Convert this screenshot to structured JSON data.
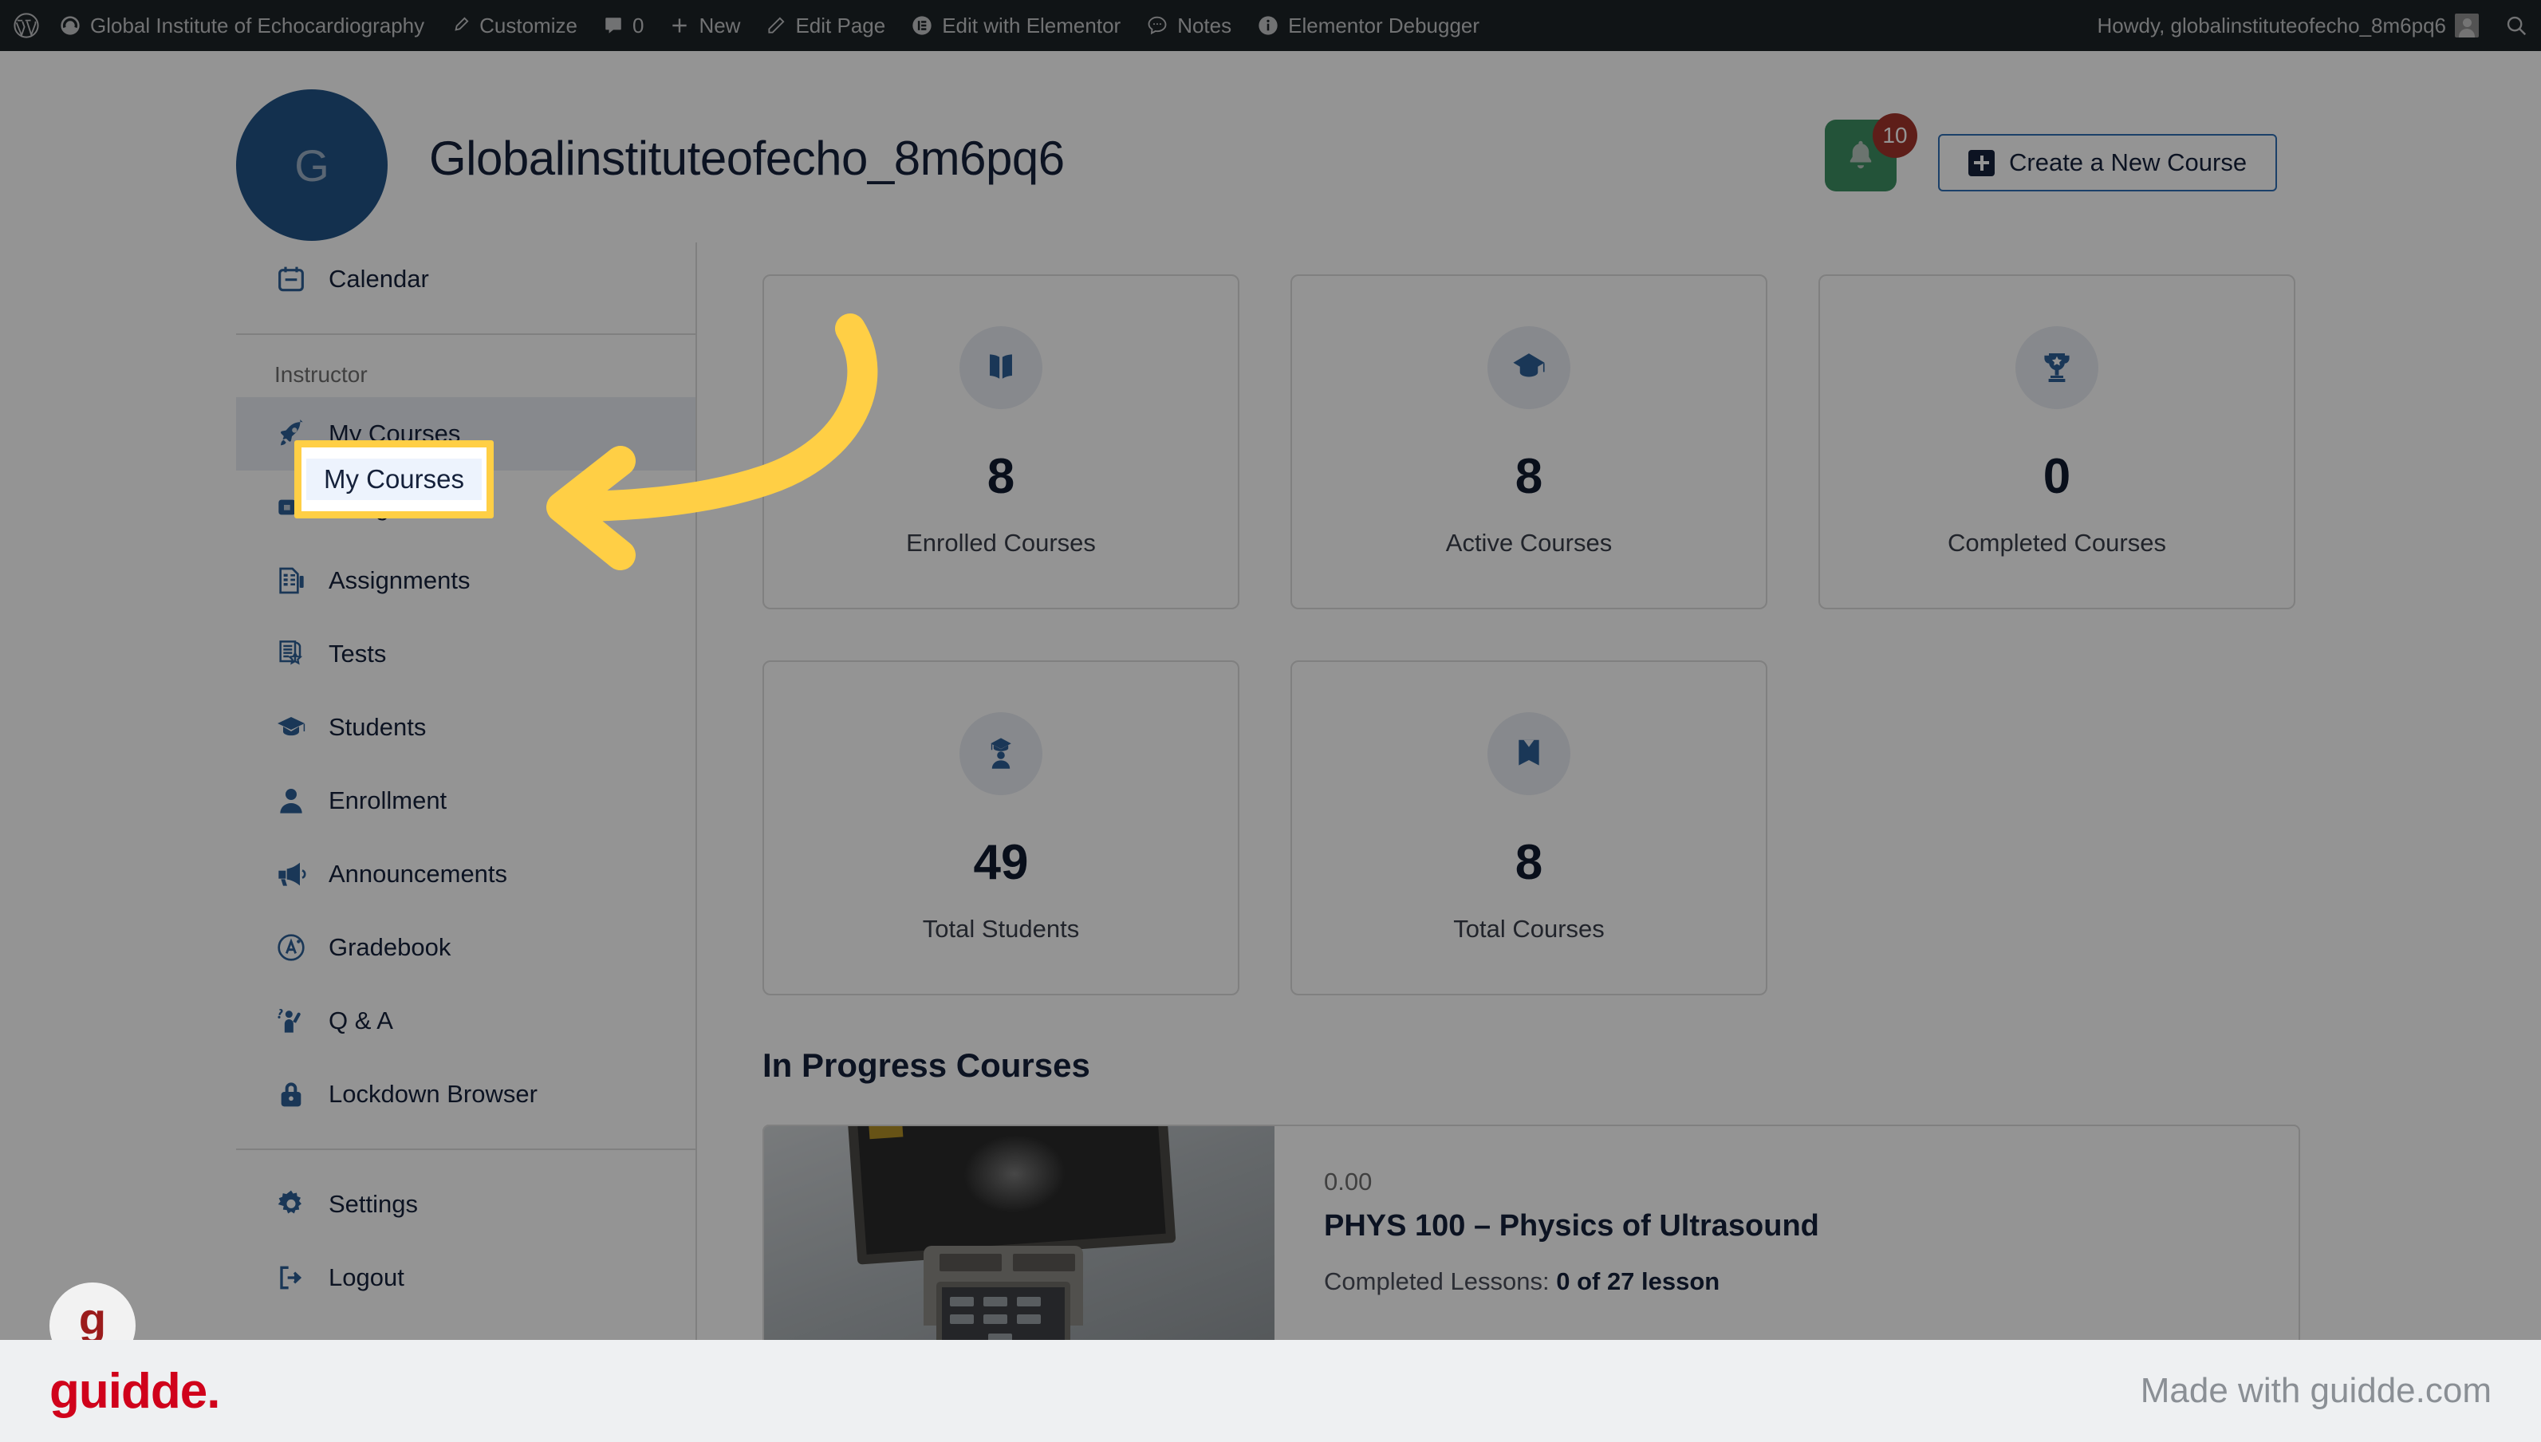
{
  "admin_bar": {
    "site_name": "Global Institute of Echocardiography",
    "items": [
      {
        "label": "Customize",
        "icon": "paintbrush-icon"
      },
      {
        "label": "0",
        "icon": "comment-icon"
      },
      {
        "label": "New",
        "icon": "plus-icon"
      },
      {
        "label": "Edit Page",
        "icon": "pencil-icon"
      },
      {
        "label": "Edit with Elementor",
        "icon": "elementor-icon"
      },
      {
        "label": "Notes",
        "icon": "notes-icon"
      },
      {
        "label": "Elementor Debugger",
        "icon": "info-icon"
      }
    ],
    "howdy": "Howdy, globalinstituteofecho_8m6pq6",
    "search_icon": "search-icon",
    "wp_logo": "wordpress-logo-icon"
  },
  "header": {
    "avatar_initial": "G",
    "title": "Globalinstituteofecho_8m6pq6",
    "notification_count": "10",
    "bell_icon": "bell-icon",
    "create_course_label": "Create a New Course"
  },
  "sidebar": {
    "top_items": [
      {
        "label": "Calendar",
        "icon": "calendar-icon"
      }
    ],
    "group_label": "Instructor",
    "instructor_items": [
      {
        "label": "My Courses",
        "icon": "rocket-icon",
        "active": true
      },
      {
        "label": "Google Meet",
        "icon": "video-camera-icon",
        "active": false
      },
      {
        "label": "Assignments",
        "icon": "assignment-doc-icon",
        "active": false
      },
      {
        "label": "Tests",
        "icon": "test-paper-icon",
        "active": false
      },
      {
        "label": "Students",
        "icon": "graduation-cap-icon",
        "active": false
      },
      {
        "label": "Enrollment",
        "icon": "person-icon",
        "active": false
      },
      {
        "label": "Announcements",
        "icon": "megaphone-icon",
        "active": false
      },
      {
        "label": "Gradebook",
        "icon": "grade-a-icon",
        "active": false
      },
      {
        "label": "Q & A",
        "icon": "raised-hand-question-icon",
        "active": false
      }
    ],
    "lockdown": {
      "label": "Lockdown Browser",
      "icon": "lock-icon"
    },
    "bottom_items": [
      {
        "label": "Settings",
        "icon": "gear-icon"
      },
      {
        "label": "Logout",
        "icon": "logout-icon"
      }
    ]
  },
  "stats": {
    "row1": [
      {
        "value": "8",
        "label": "Enrolled Courses",
        "icon": "open-book-icon"
      },
      {
        "value": "8",
        "label": "Active Courses",
        "icon": "graduation-cap-icon"
      },
      {
        "value": "0",
        "label": "Completed Courses",
        "icon": "trophy-icon"
      }
    ],
    "row2": [
      {
        "value": "49",
        "label": "Total Students",
        "icon": "student-icon"
      },
      {
        "value": "8",
        "label": "Total Courses",
        "icon": "book-ribbon-icon"
      }
    ]
  },
  "in_progress": {
    "heading": "In Progress Courses",
    "course": {
      "rating": "0.00",
      "name": "PHYS 100 – Physics of Ultrasound",
      "lessons_prefix": "Completed Lessons: ",
      "lessons_value": "0 of 27 lesson",
      "thumbnail_alt": "ultrasound-machine-photo"
    }
  },
  "guidde": {
    "highlight_label": "My Courses",
    "bubble_letter": "g",
    "logo": "guidde.",
    "made_with": "Made with guidde.com",
    "highlight_color": "#ffcf45",
    "arrow_color": "#ffcf45"
  }
}
